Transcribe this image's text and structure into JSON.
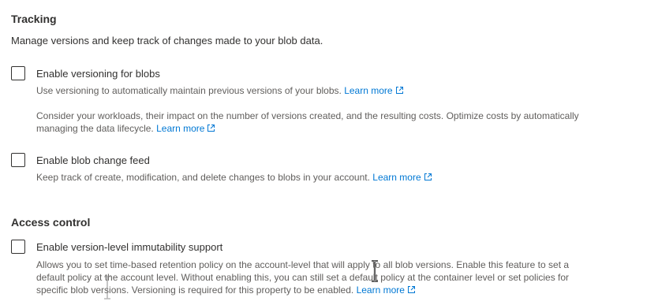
{
  "tracking": {
    "title": "Tracking",
    "description": "Manage versions and keep track of changes made to your blob data.",
    "versioning": {
      "label": "Enable versioning for blobs",
      "checked": false,
      "help1": "Use versioning to automatically maintain previous versions of your blobs.",
      "help1_link": "Learn more",
      "help2": "Consider your workloads, their impact on the number of versions created, and the resulting costs. Optimize costs by automatically managing the data lifecycle.",
      "help2_link": "Learn more"
    },
    "change_feed": {
      "label": "Enable blob change feed",
      "checked": false,
      "help": "Keep track of create, modification, and delete changes to blobs in your account.",
      "help_link": "Learn more"
    }
  },
  "access_control": {
    "title": "Access control",
    "immutability": {
      "label": "Enable version-level immutability support",
      "checked": false,
      "help": "Allows you to set time-based retention policy on the account-level that will apply to all blob versions. Enable this feature to set a default policy at the account level. Without enabling this, you can still set a default policy at the container level or set policies for specific blob versions. Versioning is required for this property to be enabled.",
      "help_link": "Learn more"
    }
  },
  "colors": {
    "link": "#0078d4",
    "text": "#323130",
    "secondary_text": "#605e5c"
  }
}
